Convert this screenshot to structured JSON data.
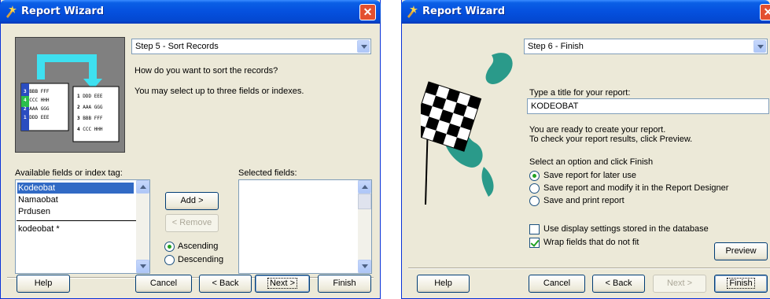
{
  "window1": {
    "title": "Report Wizard",
    "step_dropdown": "Step 5 - Sort Records",
    "question": "How do you want to sort the records?",
    "hint": "You may select up to three fields or indexes.",
    "available_label": "Available fields or index tag:",
    "available_items": [
      "Kodeobat",
      "Namaobat",
      "Prdusen"
    ],
    "index_item": "kodeobat *",
    "selected_label": "Selected fields:",
    "add_button": "Add >",
    "remove_button": "< Remove",
    "sort_options": [
      "Ascending",
      "Descending"
    ],
    "buttons": {
      "help": "Help",
      "cancel": "Cancel",
      "back": "< Back",
      "next": "Next >",
      "finish": "Finish"
    },
    "illustration": {
      "left_card": [
        [
          "3",
          "BBB FFF"
        ],
        [
          "4",
          "CCC HHH"
        ],
        [
          "2",
          "AAA GGG"
        ],
        [
          "1",
          "DDD EEE"
        ]
      ],
      "right_card": [
        [
          "1",
          "DDD EEE"
        ],
        [
          "2",
          "AAA GGG"
        ],
        [
          "3",
          "BBB FFF"
        ],
        [
          "4",
          "CCC HHH"
        ]
      ]
    }
  },
  "window2": {
    "title": "Report Wizard",
    "step_dropdown": "Step 6 - Finish",
    "title_prompt": "Type a title for your report:",
    "title_value": "KODEOBAT",
    "ready_line1": "You are ready to create your report.",
    "ready_line2": "To check your report results, click Preview.",
    "select_prompt": "Select an option and click Finish",
    "options": [
      "Save report for later use",
      "Save report and modify it in the Report Designer",
      "Save and print report"
    ],
    "check_display": "Use display settings stored in the database",
    "check_wrap": "Wrap fields that do not fit",
    "preview_button": "Preview",
    "buttons": {
      "help": "Help",
      "cancel": "Cancel",
      "back": "< Back",
      "next": "Next >",
      "finish": "Finish"
    }
  },
  "colors": {
    "title_blue": "#0550de",
    "face": "#ece9d8",
    "selection": "#316ac5",
    "cyan": "#3ee0f0",
    "teal": "#2a9a8a"
  }
}
